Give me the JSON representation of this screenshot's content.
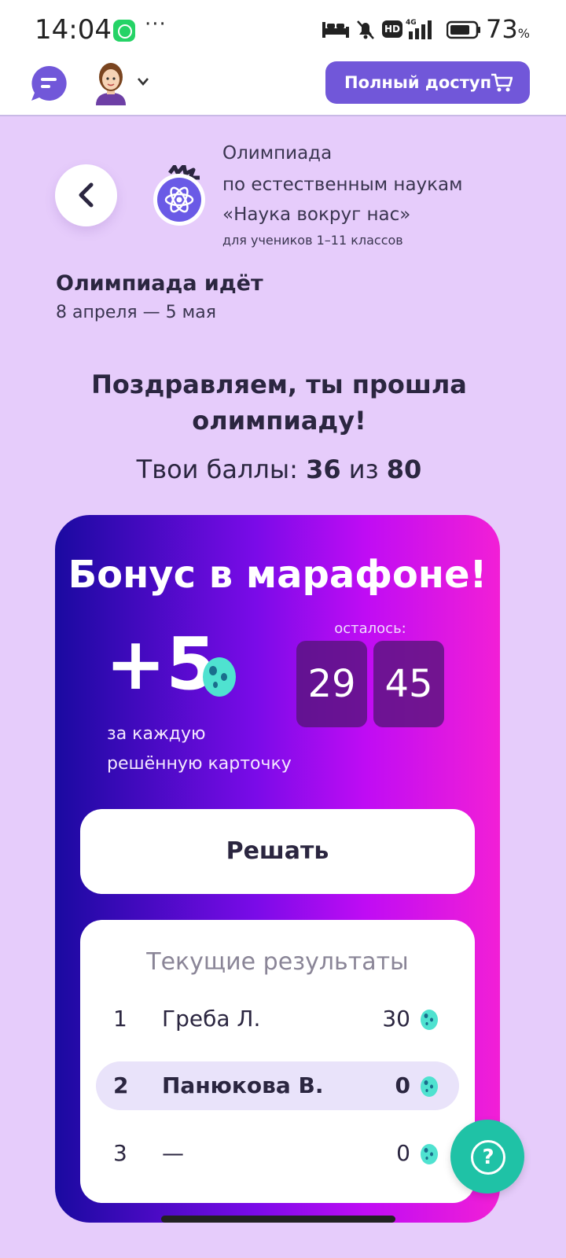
{
  "status_bar": {
    "time": "14:04",
    "more": "···",
    "hd": "HD",
    "battery_level": "73",
    "battery_unit": "%"
  },
  "header": {
    "full_access_label": "Полный доступ"
  },
  "olympiad": {
    "line1": "Олимпиада",
    "line2": "по естественным наукам",
    "line3": "«Наука вокруг нас»",
    "subtitle": "для учеников 1–11 классов",
    "status_title": "Олимпиада идёт",
    "dates": "8 апреля — 5 мая"
  },
  "result": {
    "congrats_line1": "Поздравляем, ты прошла",
    "congrats_line2": "олимпиаду!",
    "score_label": "Твои баллы:",
    "score": "36",
    "score_sep": "из",
    "score_max": "80"
  },
  "bonus": {
    "title": "Бонус в марафоне!",
    "amount": "+5",
    "desc_line1": "за каждую",
    "desc_line2": "решённую карточку",
    "remaining_label": "осталось:",
    "minutes": "29",
    "seconds": "45",
    "solve_label": "Решать"
  },
  "leaderboard": {
    "title": "Текущие результаты",
    "rows": [
      {
        "rank": "1",
        "name": "Греба Л.",
        "score": "30"
      },
      {
        "rank": "2",
        "name": "Панюкова В.",
        "score": "0"
      },
      {
        "rank": "3",
        "name": "—",
        "score": "0"
      }
    ]
  },
  "colors": {
    "page_bg": "#e6ccfb",
    "accent": "#7157d9",
    "help_button": "#1fc2a6",
    "egg": "#4fe2d0"
  },
  "icons": [
    "whatsapp-icon",
    "bed-icon",
    "bell-off-icon",
    "signal-icon",
    "battery-icon",
    "chat-icon",
    "avatar",
    "cart-icon",
    "back-arrow-icon",
    "atom-icon",
    "egg-icon",
    "help-icon"
  ]
}
